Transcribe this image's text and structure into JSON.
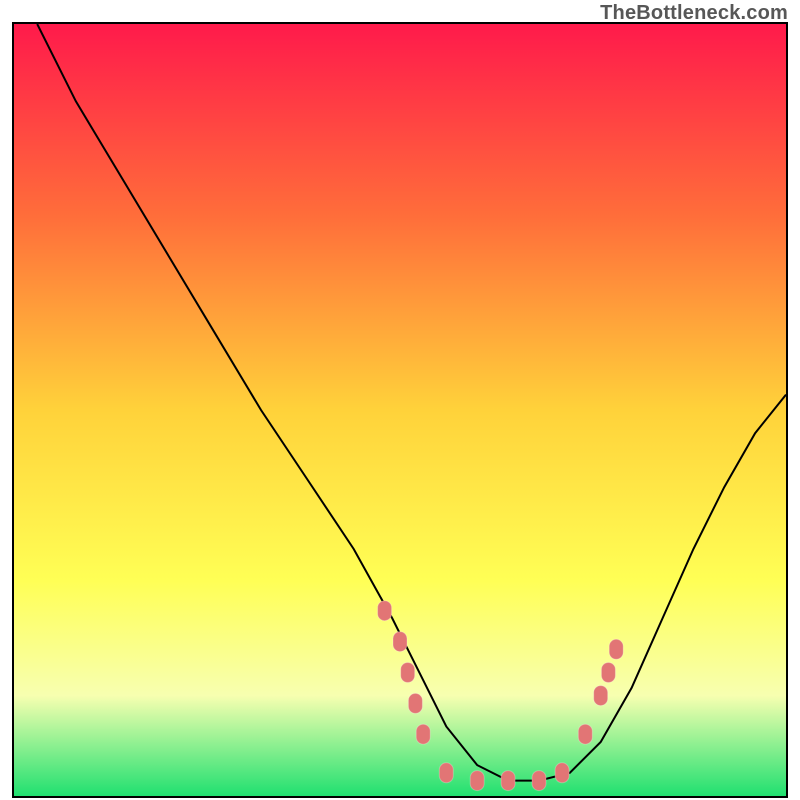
{
  "watermark": "TheBottleneck.com",
  "chart_data": {
    "type": "line",
    "title": "",
    "xlabel": "",
    "ylabel": "",
    "xlim": [
      0,
      100
    ],
    "ylim": [
      0,
      100
    ],
    "background_gradient": {
      "stops": [
        {
          "offset": 0,
          "color": "#ff1a4b"
        },
        {
          "offset": 25,
          "color": "#ff6e3a"
        },
        {
          "offset": 50,
          "color": "#ffd23a"
        },
        {
          "offset": 72,
          "color": "#ffff55"
        },
        {
          "offset": 87,
          "color": "#f7ffb0"
        },
        {
          "offset": 100,
          "color": "#20e070"
        }
      ]
    },
    "series": [
      {
        "name": "bottleneck-curve",
        "color": "#000000",
        "stroke_width": 2,
        "x": [
          3,
          8,
          14,
          20,
          26,
          32,
          38,
          44,
          49,
          53,
          56,
          60,
          64,
          68,
          72,
          76,
          80,
          84,
          88,
          92,
          96,
          100
        ],
        "y": [
          100,
          90,
          80,
          70,
          60,
          50,
          41,
          32,
          23,
          15,
          9,
          4,
          2,
          2,
          3,
          7,
          14,
          23,
          32,
          40,
          47,
          52
        ]
      }
    ],
    "markers": {
      "color": "#e27575",
      "rx": 7,
      "ry": 10,
      "points": [
        {
          "x": 48,
          "y": 24
        },
        {
          "x": 50,
          "y": 20
        },
        {
          "x": 51,
          "y": 16
        },
        {
          "x": 52,
          "y": 12
        },
        {
          "x": 53,
          "y": 8
        },
        {
          "x": 56,
          "y": 3
        },
        {
          "x": 60,
          "y": 2
        },
        {
          "x": 64,
          "y": 2
        },
        {
          "x": 68,
          "y": 2
        },
        {
          "x": 71,
          "y": 3
        },
        {
          "x": 74,
          "y": 8
        },
        {
          "x": 76,
          "y": 13
        },
        {
          "x": 77,
          "y": 16
        },
        {
          "x": 78,
          "y": 19
        }
      ]
    }
  }
}
